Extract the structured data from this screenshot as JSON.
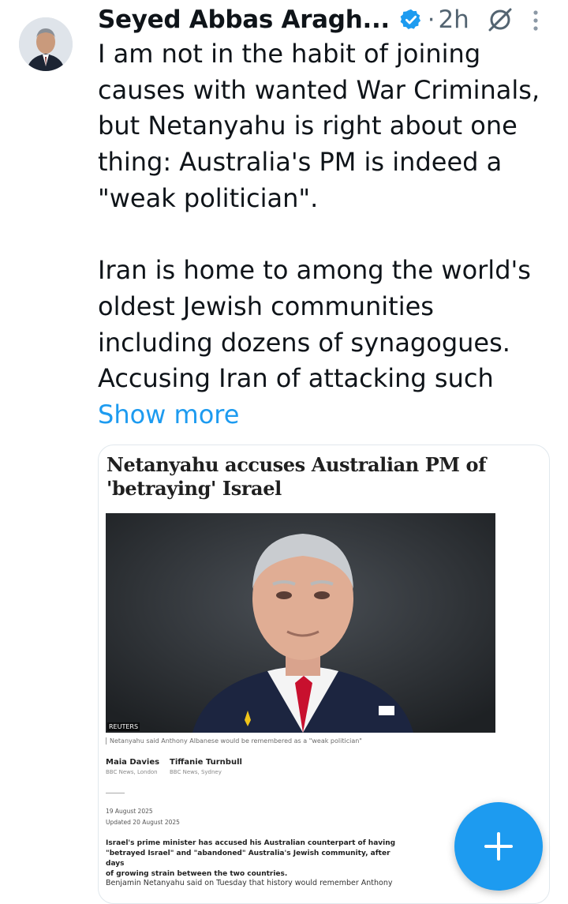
{
  "post": {
    "author_name": "Seyed Abbas Aragh...",
    "separator": "·",
    "timestamp": "2h",
    "text_lines": [
      "I am not in the habit of joining",
      "causes with wanted War Criminals,",
      "but Netanyahu is right about one",
      "thing: Australia's PM is indeed a",
      "\"weak politician\"."
    ],
    "text_lines_2": [
      "Iran is home to among the world's",
      "oldest Jewish communities",
      "including dozens of synagogues.",
      "Accusing Iran of attacking such"
    ],
    "show_more_label": "Show more"
  },
  "card": {
    "title_line1": "Netanyahu accuses Australian PM of",
    "title_line2": "'betraying' Israel",
    "photo_credit": "REUTERS",
    "caption": "Netanyahu said Anthony Albanese would be remembered as a \"weak politician\"",
    "authors": [
      {
        "name": "Maia Davies",
        "location": "BBC News, London"
      },
      {
        "name": "Tiffanie Turnbull",
        "location": "BBC News, Sydney"
      }
    ],
    "date_published": "19 August 2025",
    "date_updated": "Updated 20 August 2025",
    "lede_lines": [
      "Israel's prime minister has accused his Australian counterpart of having",
      "\"betrayed Israel\" and \"abandoned\" Australia's Jewish community, after days",
      "of growing strain between the two countries."
    ],
    "body_start": "Benjamin Netanyahu said on Tuesday that history would remember Anthony"
  },
  "colors": {
    "accent": "#1d9bf0",
    "text": "#0f1419",
    "muted": "#536471"
  },
  "icons": [
    "verified-badge-icon",
    "grok-icon",
    "more-options-icon",
    "plus-icon"
  ]
}
